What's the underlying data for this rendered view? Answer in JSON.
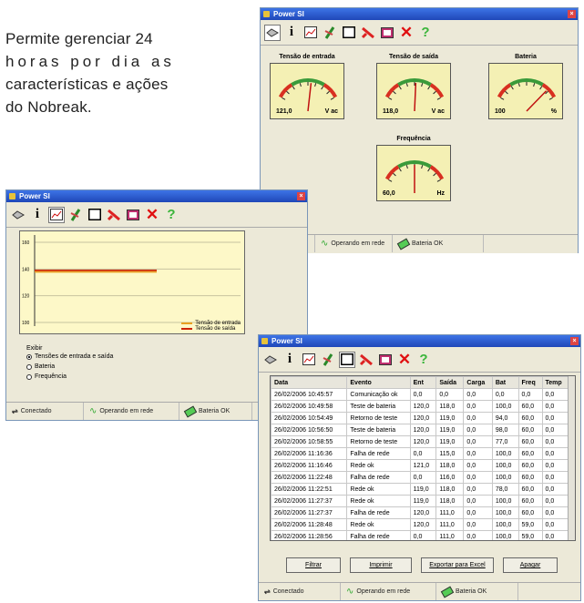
{
  "description": [
    "Permite gerenciar 24",
    "horas por dia as",
    "características e ações",
    "do Nobreak."
  ],
  "toolbar_icons": [
    "plug-icon",
    "info-icon",
    "chart-icon",
    "schedule-icon",
    "window-icon",
    "tools-icon",
    "book-icon",
    "close-icon",
    "help-icon"
  ],
  "win_top": {
    "title": "Power SI",
    "gauges": [
      {
        "label": "Tensão de entrada",
        "value": "121,0",
        "unit": "V ac",
        "level": 0.55
      },
      {
        "label": "Tensão de saída",
        "value": "118,0",
        "unit": "V ac",
        "level": 0.52
      },
      {
        "label": "Bateria",
        "value": "100",
        "unit": "%",
        "level": 0.85
      },
      {
        "label": "Frequência",
        "value": "60,0",
        "unit": "Hz",
        "level": 0.5
      }
    ],
    "status": [
      "Operando em rede",
      "Bateria OK"
    ]
  },
  "win_left": {
    "title": "Power SI",
    "chart_data": {
      "type": "line",
      "title": "",
      "y_ticks": [
        "160",
        "140",
        "120",
        "100"
      ],
      "series": [
        {
          "name": "Tensão de entrada",
          "color": "#e8a020",
          "value": 0.37
        },
        {
          "name": "Tensão de saída",
          "color": "#cc2200",
          "value": 0.35
        }
      ]
    },
    "options_title": "Exibir",
    "options": [
      "Tensões de entrada e saída",
      "Bateria",
      "Frequência"
    ],
    "status": [
      "Conectado",
      "Operando em rede",
      "Bateria OK"
    ]
  },
  "win_bottom": {
    "title": "Power SI",
    "columns": [
      "Data",
      "Evento",
      "Ent",
      "Saída",
      "Carga",
      "Bat",
      "Freq",
      "Temp"
    ],
    "rows": [
      [
        "26/02/2006 10:45:57",
        "Comunicação ok",
        "0,0",
        "0,0",
        "0,0",
        "0,0",
        "0,0",
        "0,0"
      ],
      [
        "26/02/2006 10:49:58",
        "Teste de bateria",
        "120,0",
        "118,0",
        "0,0",
        "100,0",
        "60,0",
        "0,0"
      ],
      [
        "26/02/2006 10:54:49",
        "Retorno de teste",
        "120,0",
        "119,0",
        "0,0",
        "94,0",
        "60,0",
        "0,0"
      ],
      [
        "26/02/2006 10:56:50",
        "Teste de bateria",
        "120,0",
        "119,0",
        "0,0",
        "98,0",
        "60,0",
        "0,0"
      ],
      [
        "26/02/2006 10:58:55",
        "Retorno de teste",
        "120,0",
        "119,0",
        "0,0",
        "77,0",
        "60,0",
        "0,0"
      ],
      [
        "26/02/2006 11:16:36",
        "Falha de rede",
        "0,0",
        "115,0",
        "0,0",
        "100,0",
        "60,0",
        "0,0"
      ],
      [
        "26/02/2006 11:16:46",
        "Rede ok",
        "121,0",
        "118,0",
        "0,0",
        "100,0",
        "60,0",
        "0,0"
      ],
      [
        "26/02/2006 11:22:48",
        "Falha de rede",
        "0,0",
        "116,0",
        "0,0",
        "100,0",
        "60,0",
        "0,0"
      ],
      [
        "26/02/2006 11:22:51",
        "Rede ok",
        "119,0",
        "118,0",
        "0,0",
        "78,0",
        "60,0",
        "0,0"
      ],
      [
        "26/02/2006 11:27:37",
        "Rede ok",
        "119,0",
        "118,0",
        "0,0",
        "100,0",
        "60,0",
        "0,0"
      ],
      [
        "26/02/2006 11:27:37",
        "Falha de rede",
        "120,0",
        "111,0",
        "0,0",
        "100,0",
        "60,0",
        "0,0"
      ],
      [
        "26/02/2006 11:28:48",
        "Rede ok",
        "120,0",
        "111,0",
        "0,0",
        "100,0",
        "59,0",
        "0,0"
      ],
      [
        "26/02/2006 11:28:56",
        "Falha de rede",
        "0,0",
        "111,0",
        "0,0",
        "100,0",
        "59,0",
        "0,0"
      ],
      [
        "26/02/2006 11:29:19",
        "Rede ok",
        "121,0",
        "111,0",
        "0,0",
        "98,0",
        "59,0",
        "0,0"
      ]
    ],
    "buttons": [
      "Filtrar",
      "Imprimir",
      "Exportar para Excel",
      "Apagar"
    ],
    "status": [
      "Conectado",
      "Operando em rede",
      "Bateria OK"
    ]
  }
}
